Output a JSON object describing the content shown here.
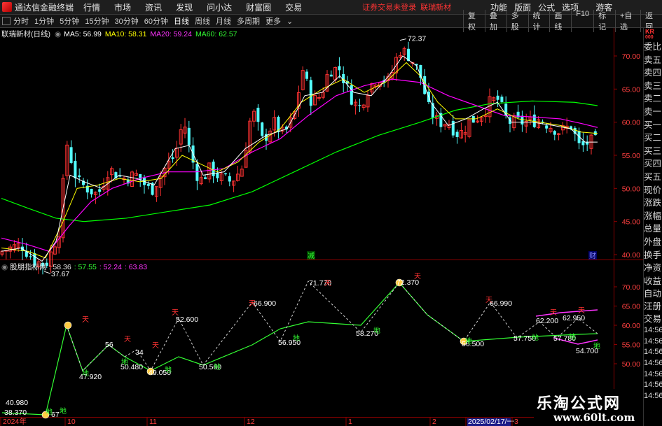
{
  "menubar": {
    "app_name": "通达信金融终端",
    "items": [
      "行情",
      "市场",
      "资讯",
      "发现",
      "问小达",
      "财富圈",
      "交易"
    ],
    "notice": "证券交易未登录",
    "stock": "联瑞新材",
    "right_items": [
      "功能",
      "版面",
      "公式",
      "选项"
    ],
    "guest": "游客"
  },
  "periodbar": {
    "periods": [
      "分时",
      "1分钟",
      "5分钟",
      "15分钟",
      "30分钟",
      "60分钟",
      "日线",
      "周线",
      "月线",
      "多周期",
      "更多"
    ],
    "active": "日线",
    "tools": [
      "复权",
      "叠加",
      "多股",
      "统计",
      "画线",
      "F10",
      "标记",
      "+自选",
      "返回"
    ]
  },
  "main_chart": {
    "title": "联瑞新材(日线)",
    "ma_labels": [
      {
        "text": "MA5: 56.99",
        "color": "#ffffff"
      },
      {
        "text": "MA10: 58.31",
        "color": "#ffff00"
      },
      {
        "text": "MA20: 59.24",
        "color": "#ff00ff"
      },
      {
        "text": "MA60: 62.57",
        "color": "#00ff00"
      }
    ],
    "y_ticks": [
      "70.00",
      "65.00",
      "60.00",
      "55.00",
      "50.00",
      "45.00",
      "40.00"
    ],
    "high_label": "72.37",
    "low_label": "37.67",
    "badge_jian": "减",
    "badge_cai": "财"
  },
  "indicator": {
    "title": "股朋指标网 : 58.36",
    "values": [
      {
        "text": ": 57.55",
        "color": "#33ff33"
      },
      {
        "text": ": 52.24",
        "color": "#ff33ff"
      },
      {
        "text": ": 63.83",
        "color": "#ff33ff"
      }
    ],
    "y_ticks": [
      "70.00",
      "65.00",
      "60.00",
      "55.00",
      "50.00"
    ],
    "point_labels": [
      "40.980",
      "38.370",
      "67",
      "47.920",
      "56",
      "50.480",
      "34",
      "49.050",
      "52.600",
      "50.560",
      "66.900",
      "56.950",
      "71.770",
      "58.270",
      "72.370",
      "56.500",
      "66.990",
      "57.750",
      "62.200",
      "57.780",
      "62.950",
      "54.700"
    ],
    "tian_label": "天",
    "di_label": "地"
  },
  "xaxis": {
    "labels": [
      "2024年",
      "10",
      "11",
      "12",
      "1",
      "2",
      "2025/02/17/一",
      "3"
    ]
  },
  "sidebar": {
    "corner": "KR",
    "corner2": "000",
    "rows": [
      "委比",
      "卖五",
      "卖四",
      "卖三",
      "卖二",
      "卖一",
      "买一",
      "买二",
      "买三",
      "买四",
      "买五",
      "现价",
      "涨跌",
      "涨幅",
      "总量",
      "外盘",
      "换手",
      "净资",
      "收益"
    ],
    "rows2": [
      "自动",
      "汪册",
      "交易"
    ],
    "times": [
      "14:56",
      "14:56",
      "14:56",
      "14:56",
      "14:56",
      "14:56",
      "14:56"
    ]
  },
  "watermark": {
    "line1": "乐淘公式网",
    "line2": "www.60lt.com"
  },
  "colors": {
    "up": "#ff3232",
    "down": "#54ffff",
    "ma5": "#ffffff",
    "ma10": "#ffff00",
    "ma20": "#ff00ff",
    "ma60": "#00ff00",
    "axis": "#8b0000"
  }
}
